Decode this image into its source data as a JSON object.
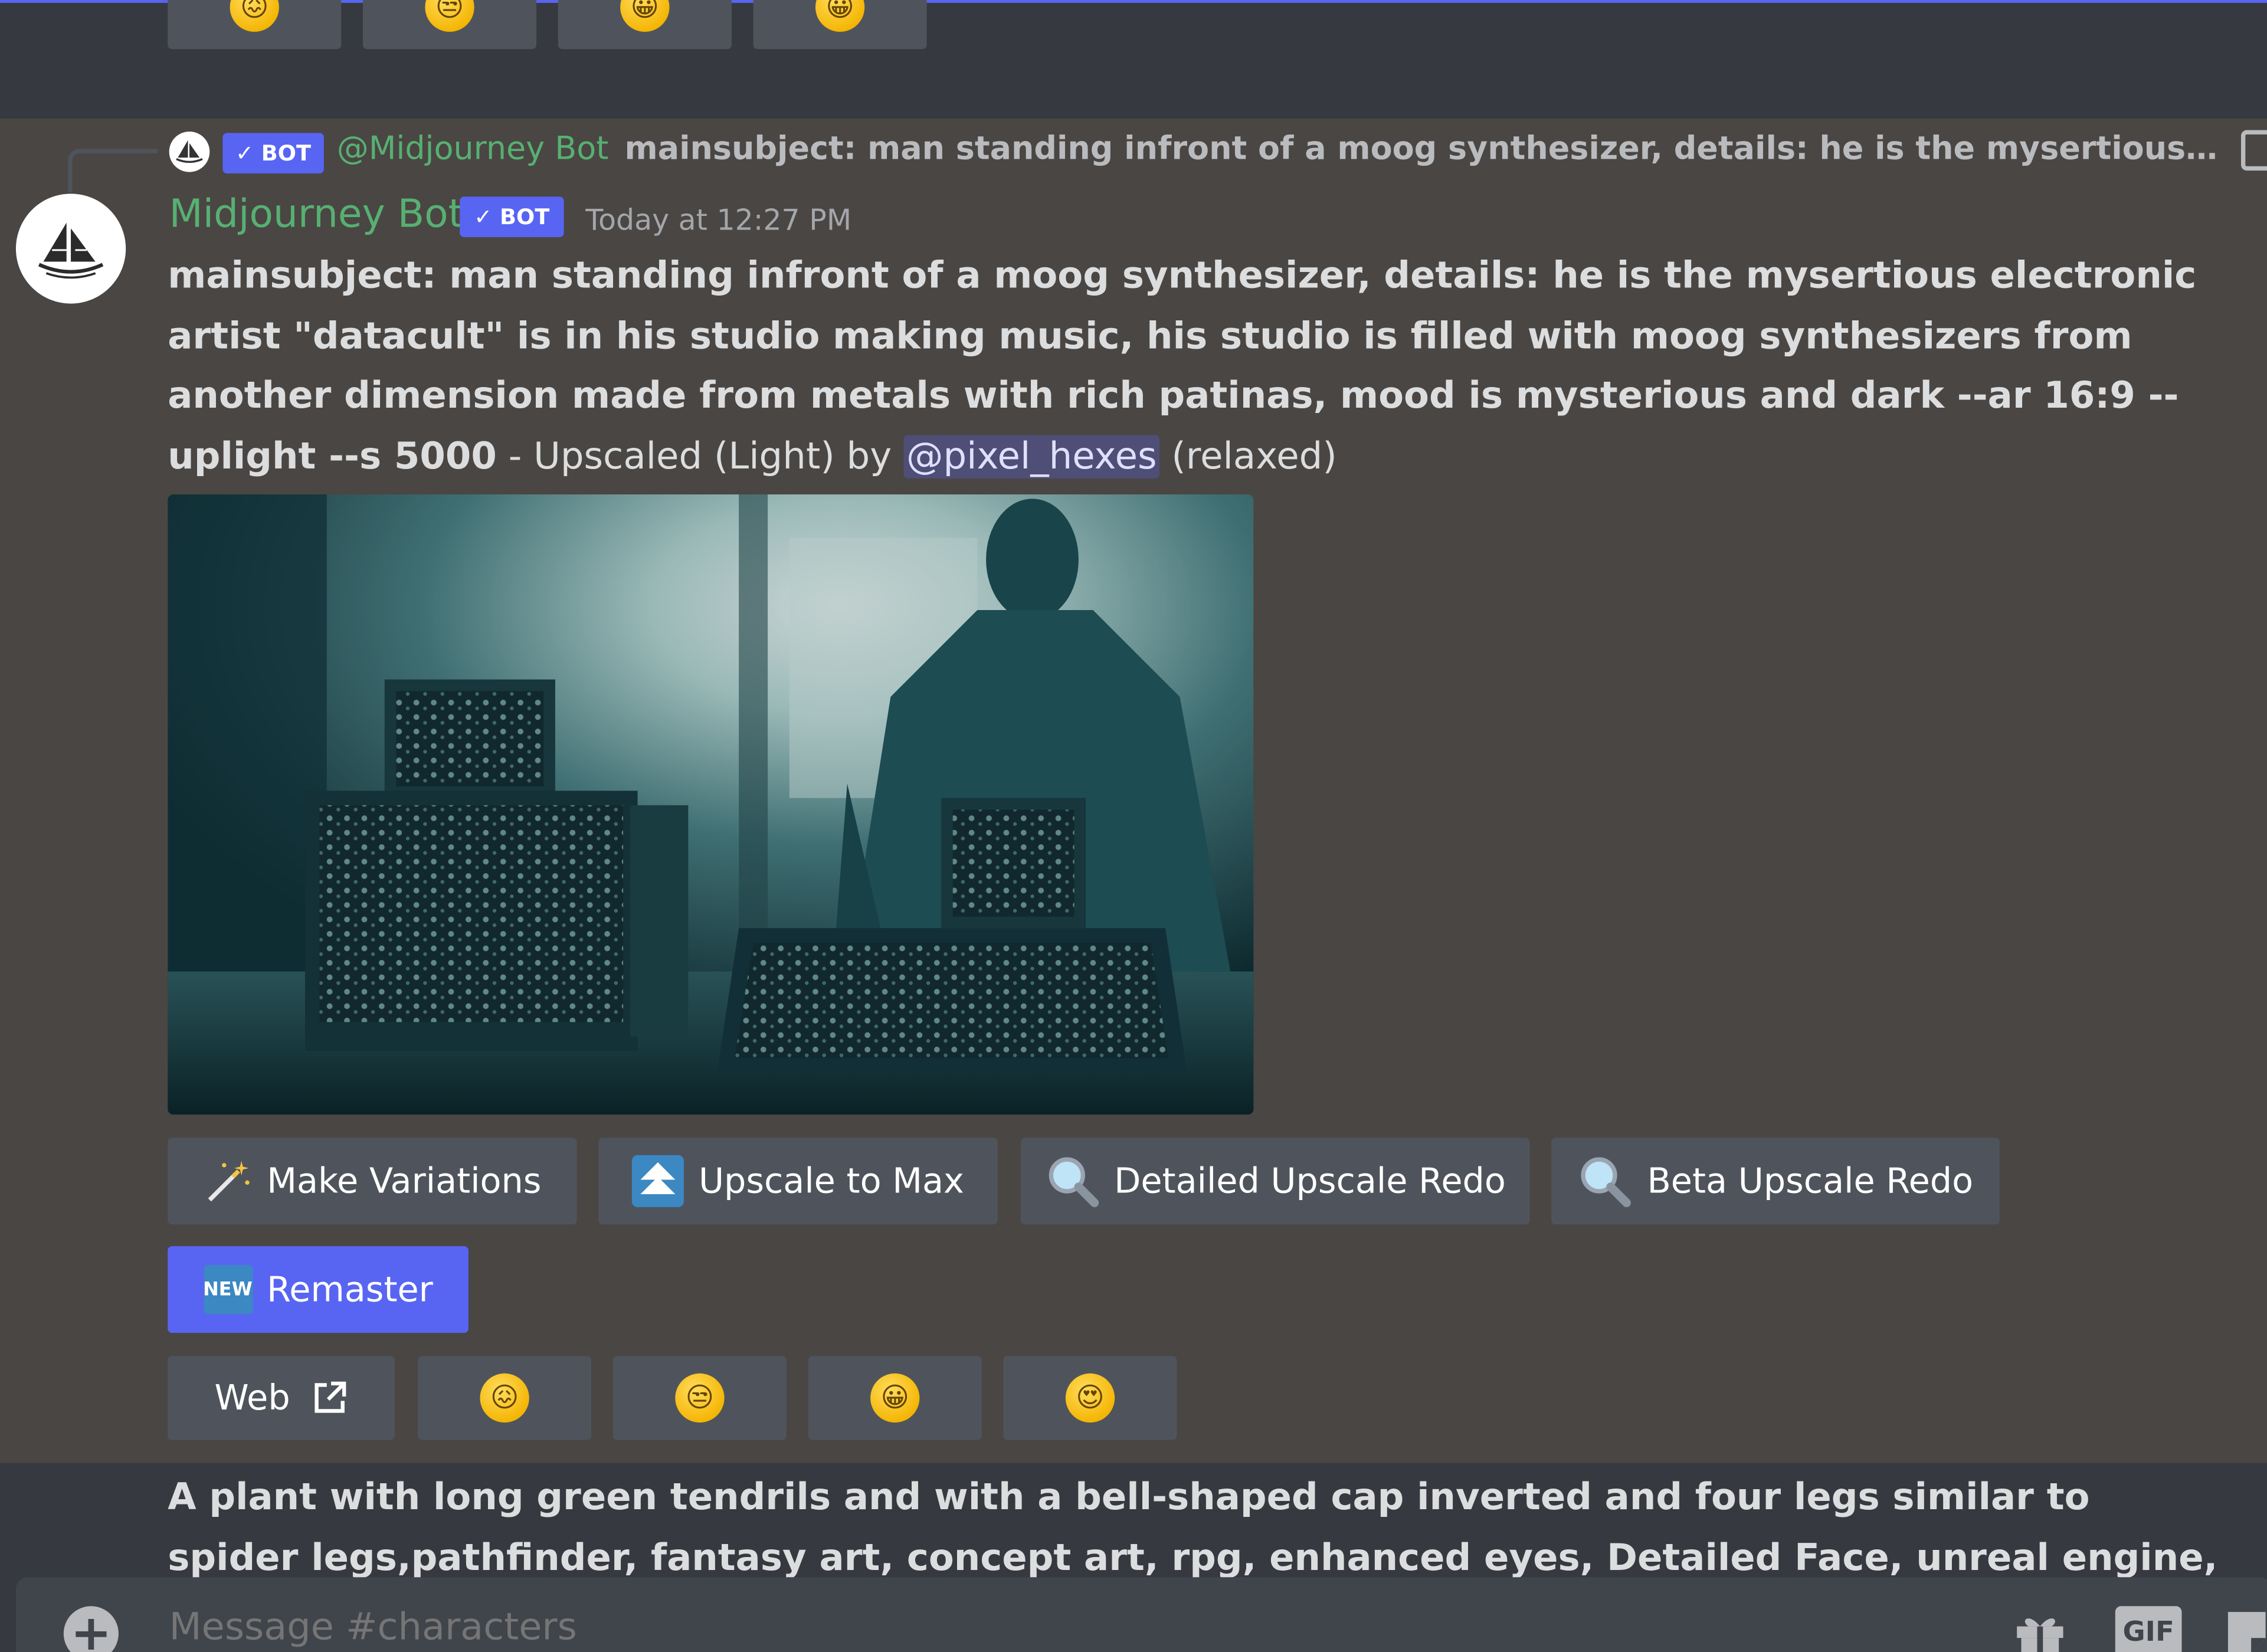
{
  "previous_message": {
    "emoji_buttons": [
      "😖",
      "😒",
      "😀",
      "😀"
    ]
  },
  "reply": {
    "bot_tag": "✓ BOT",
    "author": "@Midjourney Bot",
    "text": "mainsubject: man standing infront of a moog synthesizer, details: he is the mysertious electronic artist \"datacult\" is in his studio making music, his studio is filled with moog synthesizers from another dimension made from metals with rich patinas, mood is mysterious and dark --ar 16:9 --uplight --s 5000"
  },
  "message": {
    "author": "Midjourney Bot",
    "bot_tag": "✓ BOT",
    "timestamp": "Today at 12:27 PM",
    "prompt": "mainsubject: man standing infront of a moog synthesizer, details: he is the mysertious electronic artist \"datacult\" is in his studio making music, his studio is filled with moog synthesizers from another dimension made from metals with rich patinas, mood is mysterious and dark --ar 16:9 --uplight --s 5000",
    "suffix": " - Upscaled (Light) by ",
    "mention": "@pixel_hexes",
    "mode": " (relaxed)"
  },
  "buttons": {
    "make_variations": "Make Variations",
    "upscale_to_max": "Upscale to Max",
    "detailed_upscale_redo": "Detailed Upscale Redo",
    "beta_upscale_redo": "Beta Upscale Redo",
    "remaster_badge": "NEW",
    "remaster": "Remaster",
    "web": "Web"
  },
  "reactions": [
    "😖",
    "😒",
    "😀",
    "😍"
  ],
  "next_message": {
    "text": "A plant with long green tendrils and with a bell-shaped cap inverted and four legs similar to spider legs,pathfinder, fantasy art, concept art, rpg, enhanced eyes, Detailed Face, unreal engine, Painting,"
  },
  "composer": {
    "placeholder": "Message #characters",
    "gif_label": "GIF"
  },
  "colors": {
    "accent": "#5865f2",
    "bot_name": "#57b072",
    "highlight_bg": "#4a4643",
    "background": "#36393f",
    "button_bg": "#4f545c"
  }
}
